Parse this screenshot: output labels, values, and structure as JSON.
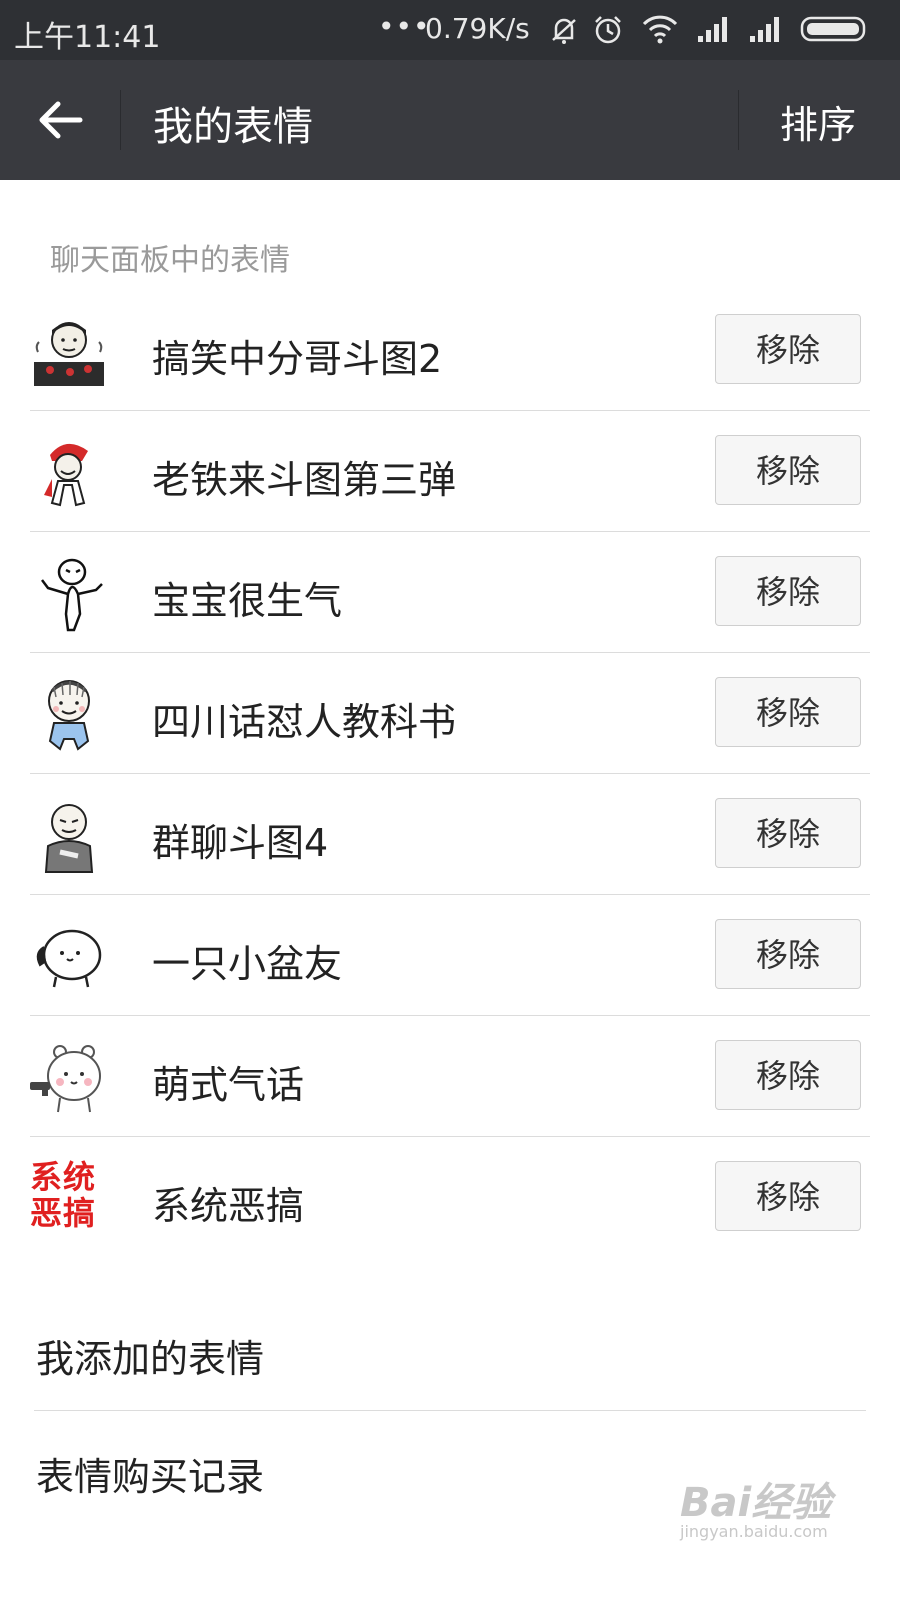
{
  "status_bar": {
    "time": "上午11:41",
    "network_speed": "0.79K/s",
    "icons": [
      "more-dots-icon",
      "mute-bell-icon",
      "alarm-clock-icon",
      "wifi-icon",
      "signal-1-icon",
      "signal-2-icon",
      "battery-icon"
    ]
  },
  "header": {
    "back_icon": "arrow-left-icon",
    "title": "我的表情",
    "sort_label": "排序"
  },
  "section": {
    "title": "聊天面板中的表情"
  },
  "sticker_packs": [
    {
      "name": "搞笑中分哥斗图2",
      "button": "移除",
      "thumb": "meme-man-icon"
    },
    {
      "name": "老铁来斗图第三弹",
      "button": "移除",
      "thumb": "red-cap-meme-icon"
    },
    {
      "name": "宝宝很生气",
      "button": "移除",
      "thumb": "angry-doodle-icon"
    },
    {
      "name": "四川话怼人教科书",
      "button": "移除",
      "thumb": "blue-overalls-kid-icon"
    },
    {
      "name": "群聊斗图4",
      "button": "移除",
      "thumb": "grey-shirt-meme-icon"
    },
    {
      "name": "一只小盆友",
      "button": "移除",
      "thumb": "round-white-buddy-icon"
    },
    {
      "name": "萌式气话",
      "button": "移除",
      "thumb": "cute-bear-icon"
    },
    {
      "name": "系统恶搞",
      "button": "移除",
      "thumb_text_1": "系统",
      "thumb_text_2": "恶搞"
    }
  ],
  "entries": {
    "my_added": "我添加的表情",
    "purchase_history": "表情购买记录"
  },
  "watermark": {
    "brand": "Bai经验",
    "url": "jingyan.baidu.com"
  },
  "colors": {
    "status_bar": "#2e3034",
    "title_bar": "#393a3f",
    "accent_red": "#e02020"
  }
}
